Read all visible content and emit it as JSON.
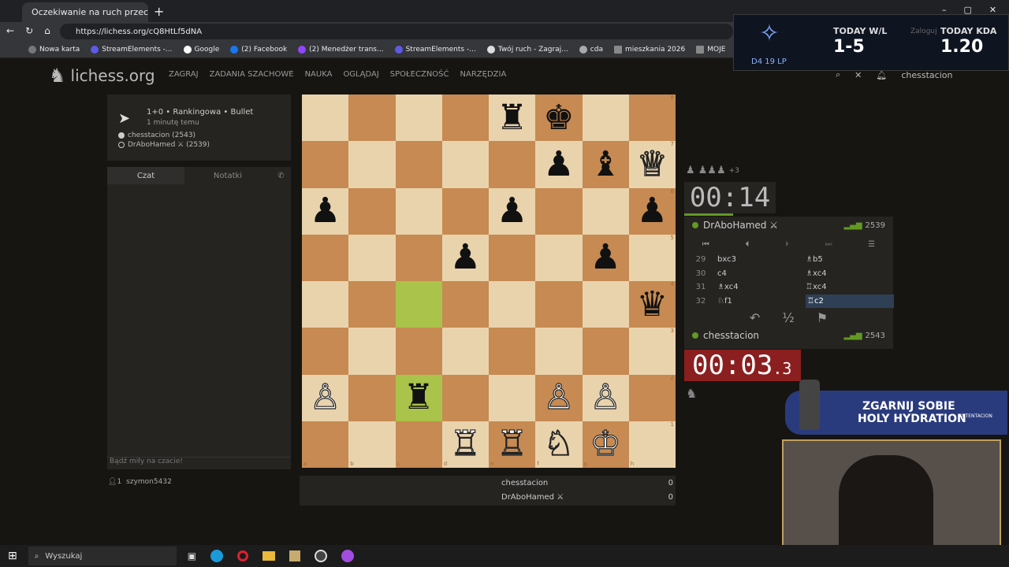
{
  "browser": {
    "tab_title": "Oczekiwanie na ruch przeciw",
    "url": "https://lichess.org/cQ8HtLf5dNA",
    "bookmarks": [
      "Nowa karta",
      "StreamElements -...",
      "Google",
      "(2) Facebook",
      "(2) Menedżer trans...",
      "StreamElements -...",
      "Twój ruch - Zagraj...",
      "cda",
      "mieszkania 2026",
      "MOJE"
    ]
  },
  "site": {
    "logo": "lichess.org",
    "nav": [
      "ZAGRAJ",
      "ZADANIA SZACHOWE",
      "NAUKA",
      "OGLĄDAJ",
      "SPOŁECZNOŚĆ",
      "NARZĘDZIA"
    ],
    "username": "chesstacion"
  },
  "game": {
    "type": "1+0 • Rankingowa • Bullet",
    "time_ago": "1 minutę temu",
    "white_player": "chesstacion (2543)",
    "black_player": "DrAboHamed ⚔ (2539)"
  },
  "chat": {
    "tab_chat": "Czat",
    "tab_notes": "Notatki",
    "placeholder": "Bądź miły na czacie!",
    "watchers": "1",
    "watcher_name": "szymon5432"
  },
  "board": {
    "rows": [
      [
        "",
        "",
        "",
        "",
        "♜",
        "♚",
        "",
        ""
      ],
      [
        "",
        "",
        "",
        "",
        "",
        "♟",
        "♝",
        "♕"
      ],
      [
        "♟",
        "",
        "",
        "",
        "♟",
        "",
        "",
        "♟"
      ],
      [
        "",
        "",
        "",
        "♟",
        "",
        "",
        "♟",
        ""
      ],
      [
        "",
        "",
        "",
        "",
        "",
        "",
        "",
        "♛"
      ],
      [
        "",
        "",
        "",
        "",
        "",
        "",
        "",
        ""
      ],
      [
        "♙",
        "",
        "♜",
        "",
        "",
        "♙",
        "♙",
        ""
      ],
      [
        "",
        "",
        "",
        "♖",
        "♖",
        "♘",
        "♔",
        ""
      ]
    ],
    "files": [
      "a",
      "b",
      "c",
      "d",
      "e",
      "f",
      "g",
      "h"
    ],
    "ranks": [
      "8",
      "7",
      "6",
      "5",
      "4",
      "3",
      "2",
      "1"
    ]
  },
  "clock": {
    "top": "00:14",
    "bottom_main": "00:03",
    "bottom_tenths": ".3",
    "captured": "+3"
  },
  "opponent": {
    "name": "DrAboHamed ⚔",
    "rating": "2539"
  },
  "me": {
    "name": "chesstacion",
    "rating": "2543"
  },
  "moves": [
    {
      "n": "29",
      "w": "bxc3",
      "b": "♗b5"
    },
    {
      "n": "30",
      "w": "c4",
      "b": "♗xc4"
    },
    {
      "n": "31",
      "w": "♗xc4",
      "b": "♖xc4"
    },
    {
      "n": "32",
      "w": "♘f1",
      "b": "♖c2"
    }
  ],
  "score": {
    "p1": "chesstacion",
    "s1": "0",
    "p2": "DrAboHamed ⚔",
    "s2": "0"
  },
  "overlay": {
    "lp": "D4 19 LP",
    "wl_label": "TODAY W/L",
    "wl_value": "1-5",
    "kda_label": "TODAY KDA",
    "kda_value": "1.20",
    "login": "Zaloguj",
    "promo_line1": "ZGARNIJ SOBIE",
    "promo_line2": "HOLY HYDRATION",
    "promo_tag": "XNTENTACION"
  },
  "taskbar": {
    "search": "Wyszukaj"
  }
}
